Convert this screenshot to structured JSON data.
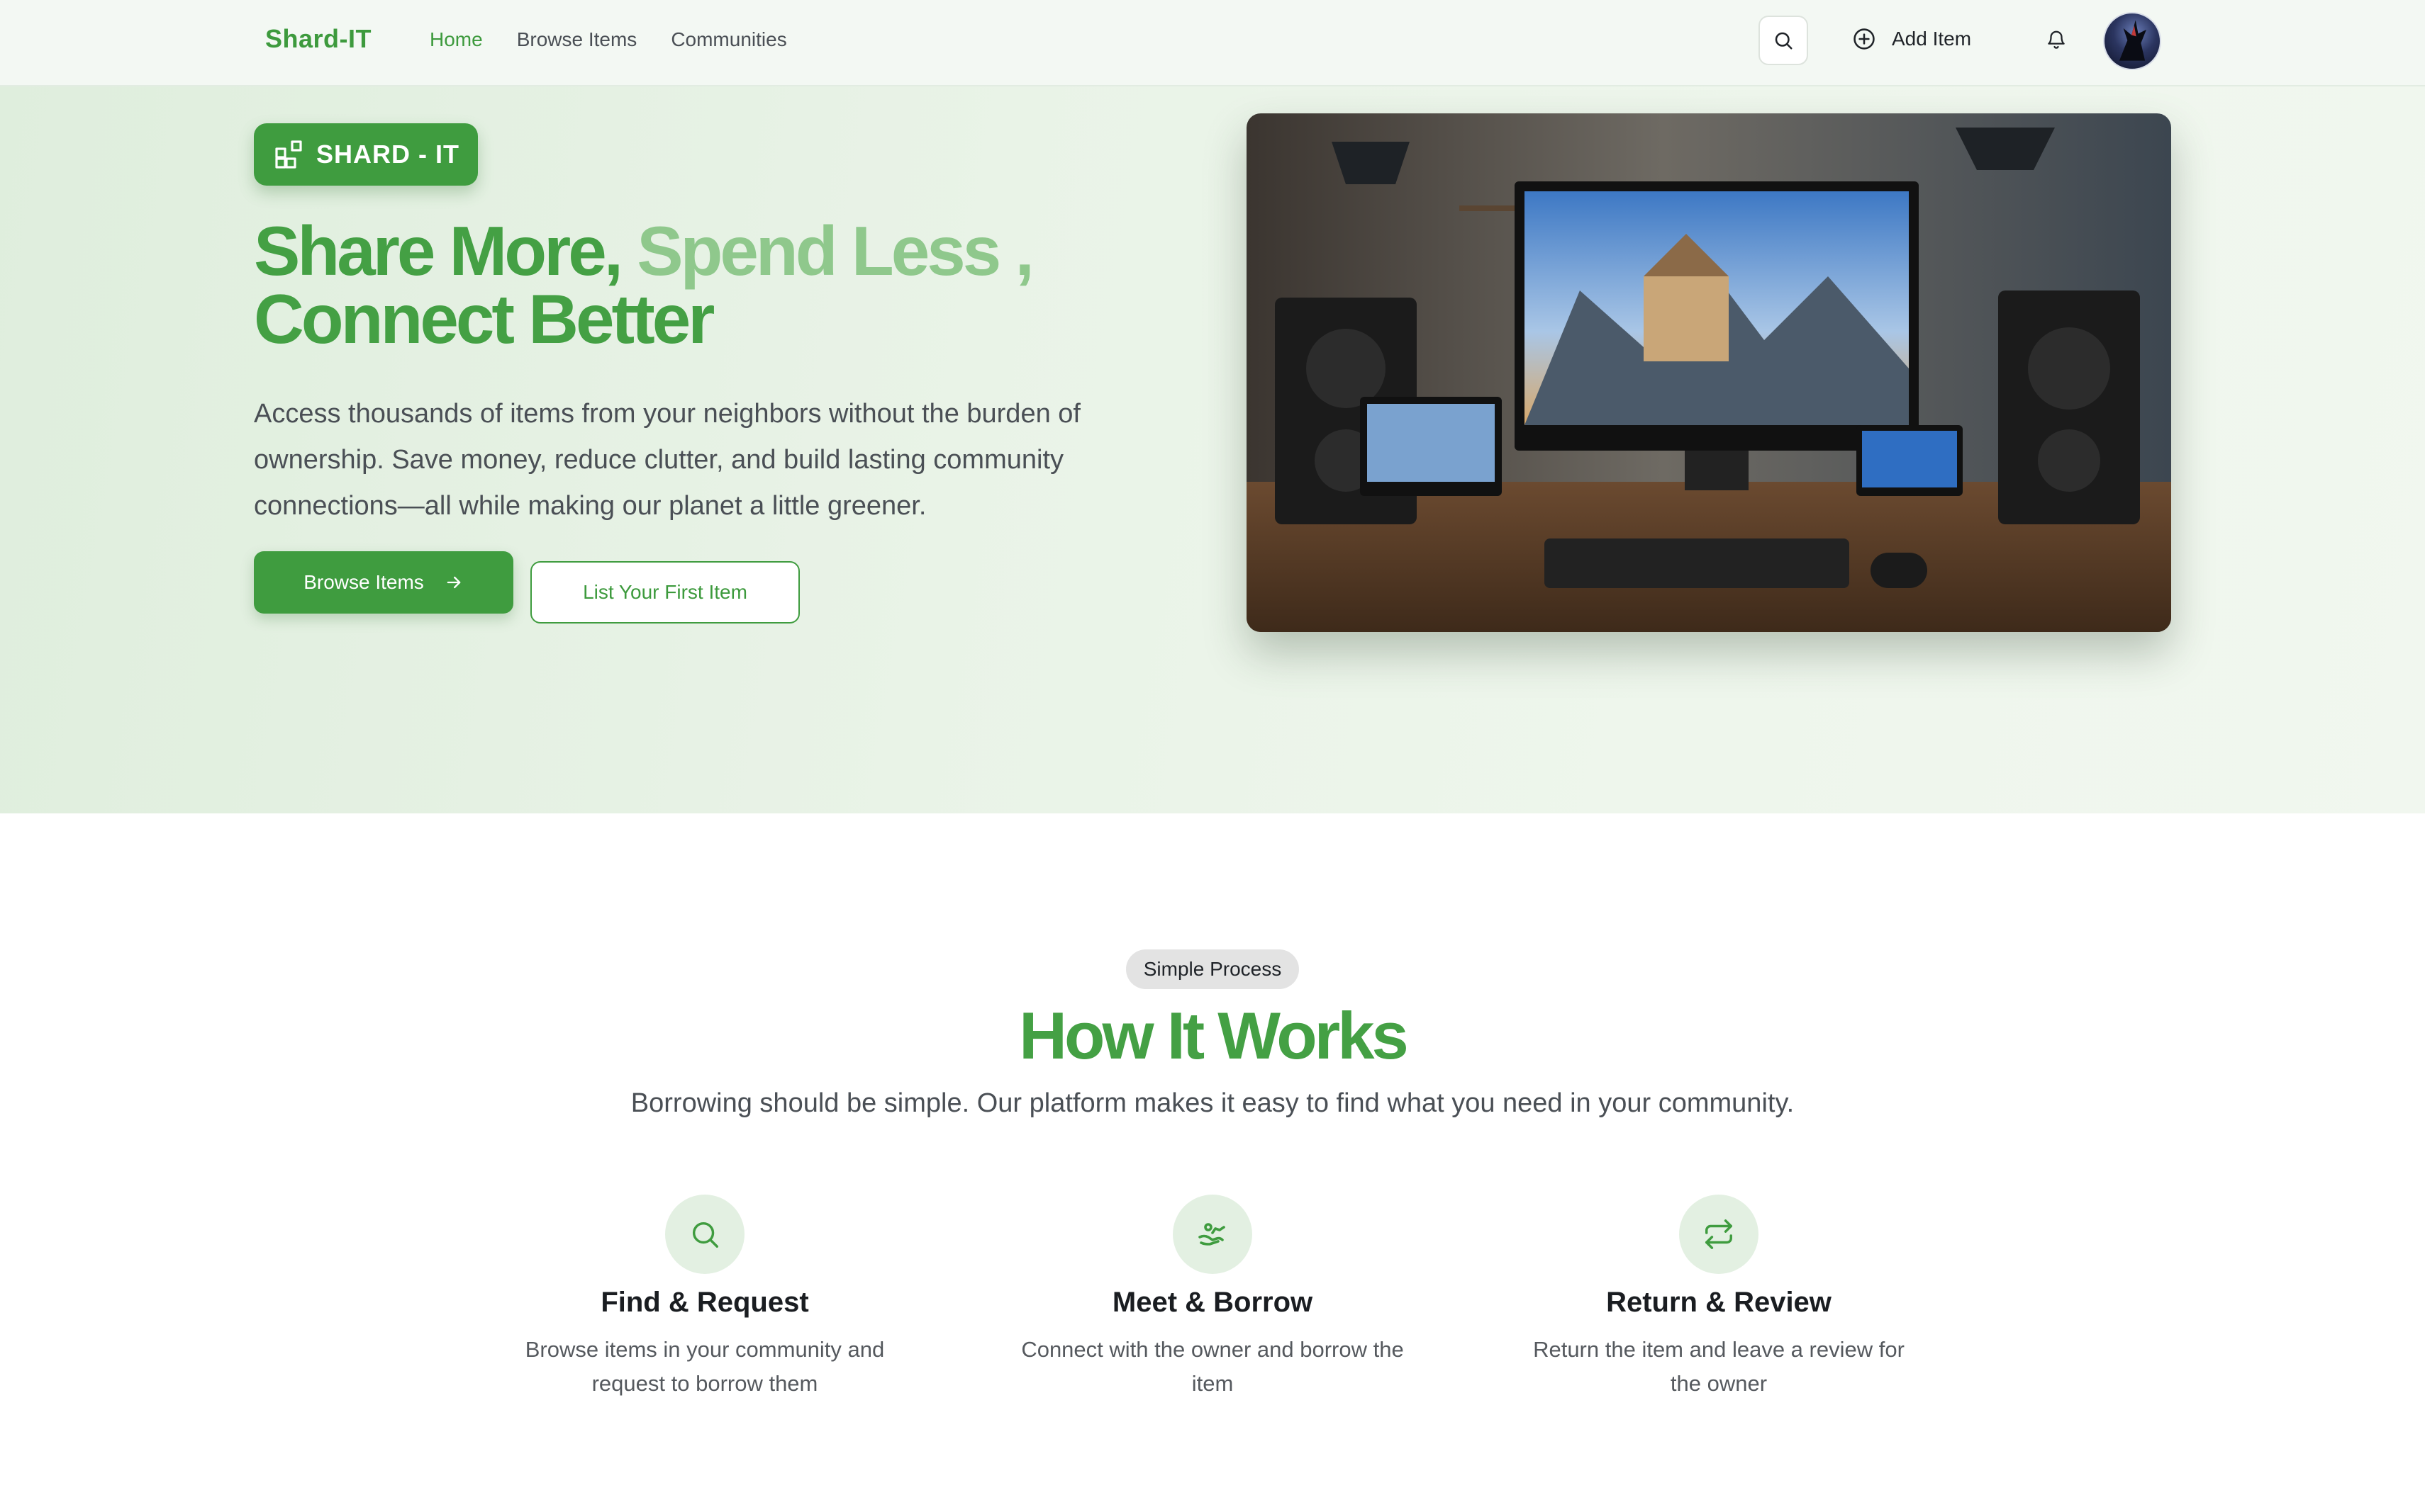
{
  "nav": {
    "brand": "Shard-IT",
    "links": [
      {
        "label": "Home",
        "active": true
      },
      {
        "label": "Browse Items",
        "active": false
      },
      {
        "label": "Communities",
        "active": false
      }
    ],
    "search_icon": "search-icon",
    "add_item_label": "Add Item",
    "notifications_icon": "bell-icon"
  },
  "hero": {
    "pill_label": "SHARD - IT",
    "headline_part1": "Share More,",
    "headline_part2": " Spend Less ,",
    "headline_part3": "Connect Better",
    "description": "Access thousands of items from your neighbors without the burden of ownership. Save money, reduce clutter, and build lasting community connections—all while making our planet a little greener.",
    "primary_button": "Browse Items",
    "secondary_button": "List Your First Item"
  },
  "how_it_works": {
    "badge": "Simple Process",
    "title": "How It Works",
    "subtitle": "Borrowing should be simple. Our platform makes it easy to find what you need in your community.",
    "steps": [
      {
        "icon": "search-icon",
        "title": "Find & Request",
        "description": "Browse items in your community and request to borrow them"
      },
      {
        "icon": "handshake-icon",
        "title": "Meet & Borrow",
        "description": "Connect with the owner and borrow the item"
      },
      {
        "icon": "repeat-icon",
        "title": "Return & Review",
        "description": "Return the item and leave a review for the owner"
      }
    ]
  },
  "colors": {
    "brand_green": "#3f9c3f",
    "light_green": "#8fc88c",
    "hero_bg": "#e6f2e4",
    "icon_bg": "#e3f0e2"
  }
}
